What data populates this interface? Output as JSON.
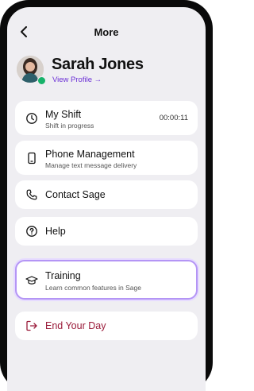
{
  "header": {
    "title": "More",
    "back_icon": "chevron-left-icon"
  },
  "profile": {
    "name": "Sarah Jones",
    "link_label": "View Profile →",
    "status_color": "#17b26a"
  },
  "menu": [
    {
      "label": "My Shift",
      "sub": "Shift in progress",
      "timer": "00:00:11",
      "icon": "clock-icon"
    },
    {
      "label": "Phone Management",
      "sub": "Manage text message delivery",
      "icon": "phone-icon"
    },
    {
      "label": "Contact Sage",
      "icon": "phone-handset-icon"
    },
    {
      "label": "Help",
      "icon": "help-circle-icon"
    },
    {
      "label": "Training",
      "sub": "Learn common features in Sage",
      "icon": "graduation-cap-icon"
    },
    {
      "label": "End Your Day",
      "icon": "log-out-icon",
      "color": "#9a1b3a"
    }
  ],
  "colors": {
    "accent": "#6b2fd6",
    "highlight_border": "#b495f5",
    "danger": "#9a1b3a"
  }
}
